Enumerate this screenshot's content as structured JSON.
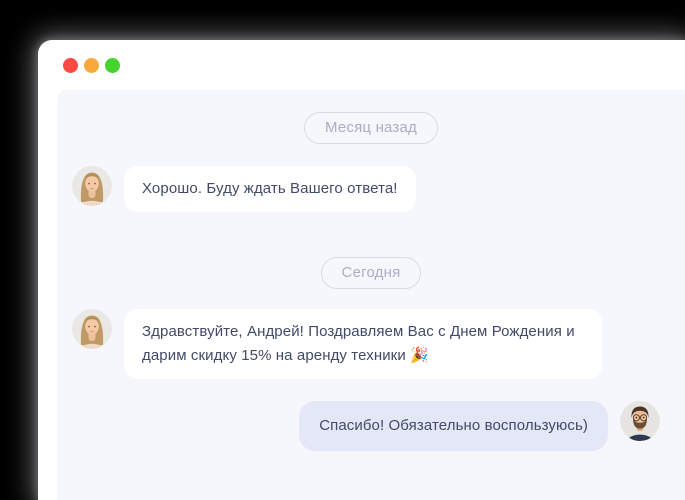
{
  "window": {
    "controls": [
      {
        "name": "close",
        "color": "#fb4a42"
      },
      {
        "name": "minimize",
        "color": "#f7a93b"
      },
      {
        "name": "maximize",
        "color": "#45d32d"
      }
    ]
  },
  "chat": {
    "dividers": [
      {
        "label": "Месяц назад"
      },
      {
        "label": "Сегодня"
      }
    ],
    "messages": [
      {
        "direction": "incoming",
        "avatar": "woman-avatar",
        "text": "Хорошо. Буду ждать Вашего ответа!"
      },
      {
        "direction": "incoming",
        "avatar": "woman-avatar",
        "text": "Здравствуйте, Андрей! Поздравляем Вас с Днем Рождения и дарим скидку 15% на аренду техники 🎉"
      },
      {
        "direction": "outgoing",
        "avatar": "man-avatar",
        "text": "Спасибо! Обязательно воспользуюсь)"
      }
    ]
  },
  "colors": {
    "page_background": "#000000",
    "window_background": "#ffffff",
    "chat_background": "#f6f7fc",
    "incoming_bubble": "#ffffff",
    "outgoing_bubble": "#e4e7f7",
    "message_text": "#414a68",
    "divider_text": "#a9aec3",
    "divider_border": "#d8dbe7"
  }
}
